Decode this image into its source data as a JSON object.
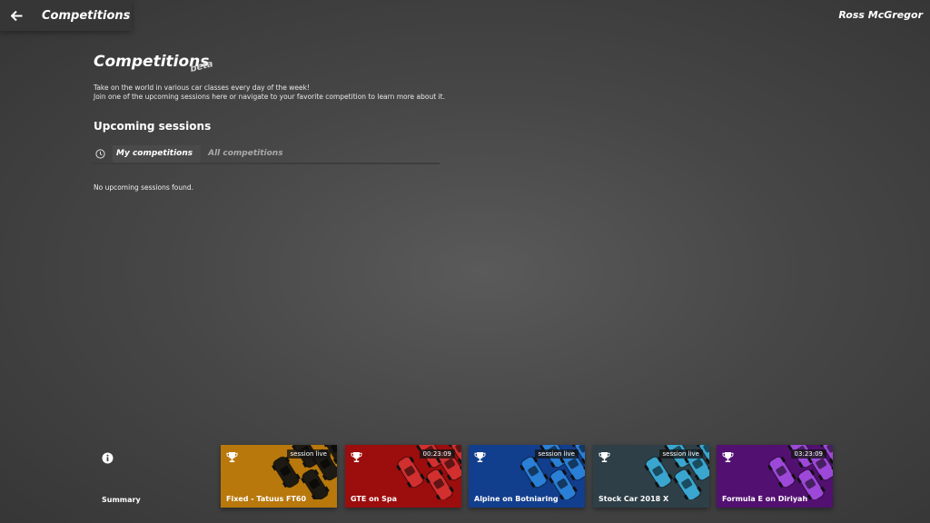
{
  "header": {
    "title": "Competitions",
    "user": "Ross McGregor"
  },
  "hero": {
    "heading": "Competitions",
    "beta": "beta",
    "line1": "Take on the world in various car classes every day of the week!",
    "line2": "Join one of the upcoming sessions here or navigate to your favorite competition to learn more about it."
  },
  "upcoming": {
    "title": "Upcoming sessions",
    "tabs": [
      "My competitions",
      "All competitions"
    ],
    "empty": "No upcoming sessions found."
  },
  "footer": {
    "summary_label": "Summary"
  },
  "cards": [
    {
      "name": "Fixed - Tatuus FT60",
      "badge": "session live",
      "color": "#b8780c",
      "car_color": "#1c1a12"
    },
    {
      "name": "GTE on Spa",
      "badge": "00:23:09",
      "color": "#9c0d0d",
      "car_color": "#d22f2f"
    },
    {
      "name": "Alpine on Botniaring",
      "badge": "session live",
      "color": "#123e8e",
      "car_color": "#2a7fd6"
    },
    {
      "name": "Stock Car 2018 X",
      "badge": "session live",
      "color": "#2e3f47",
      "car_color": "#3aa6d0"
    },
    {
      "name": "Formula E on Diriyah",
      "badge": "03:23:09",
      "color": "#521071",
      "car_color": "#9d48d8"
    }
  ]
}
